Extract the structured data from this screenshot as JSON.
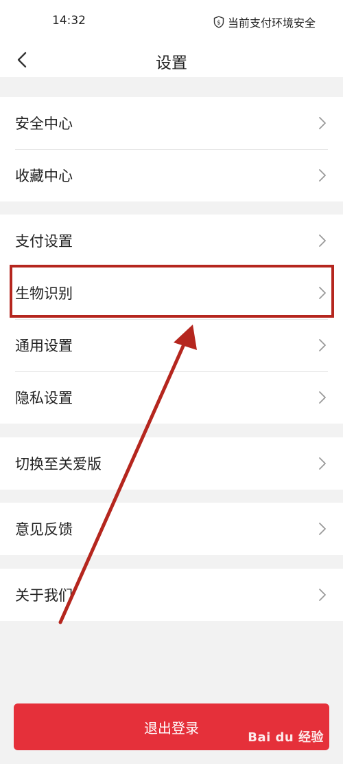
{
  "status_bar": {
    "time": "14:32",
    "safety_text": "当前支付环境安全",
    "safety_icon": "shield-dollar-icon"
  },
  "nav": {
    "back_icon": "chevron-left-icon",
    "title": "设置"
  },
  "groups": [
    {
      "items": [
        {
          "label": "安全中心"
        },
        {
          "label": "收藏中心"
        }
      ]
    },
    {
      "items": [
        {
          "label": "支付设置"
        },
        {
          "label": "生物识别"
        },
        {
          "label": "通用设置"
        },
        {
          "label": "隐私设置"
        }
      ]
    },
    {
      "items": [
        {
          "label": "切换至关爱版"
        }
      ]
    },
    {
      "items": [
        {
          "label": "意见反馈"
        }
      ]
    },
    {
      "items": [
        {
          "label": "关于我们"
        }
      ]
    }
  ],
  "logout": {
    "label": "退出登录"
  },
  "annotation": {
    "highlighted_item": "生物识别",
    "color": "#b5261e"
  },
  "watermark": {
    "text": "Bai du 经验"
  },
  "colors": {
    "accent": "#e5303a",
    "background": "#f2f2f2"
  }
}
